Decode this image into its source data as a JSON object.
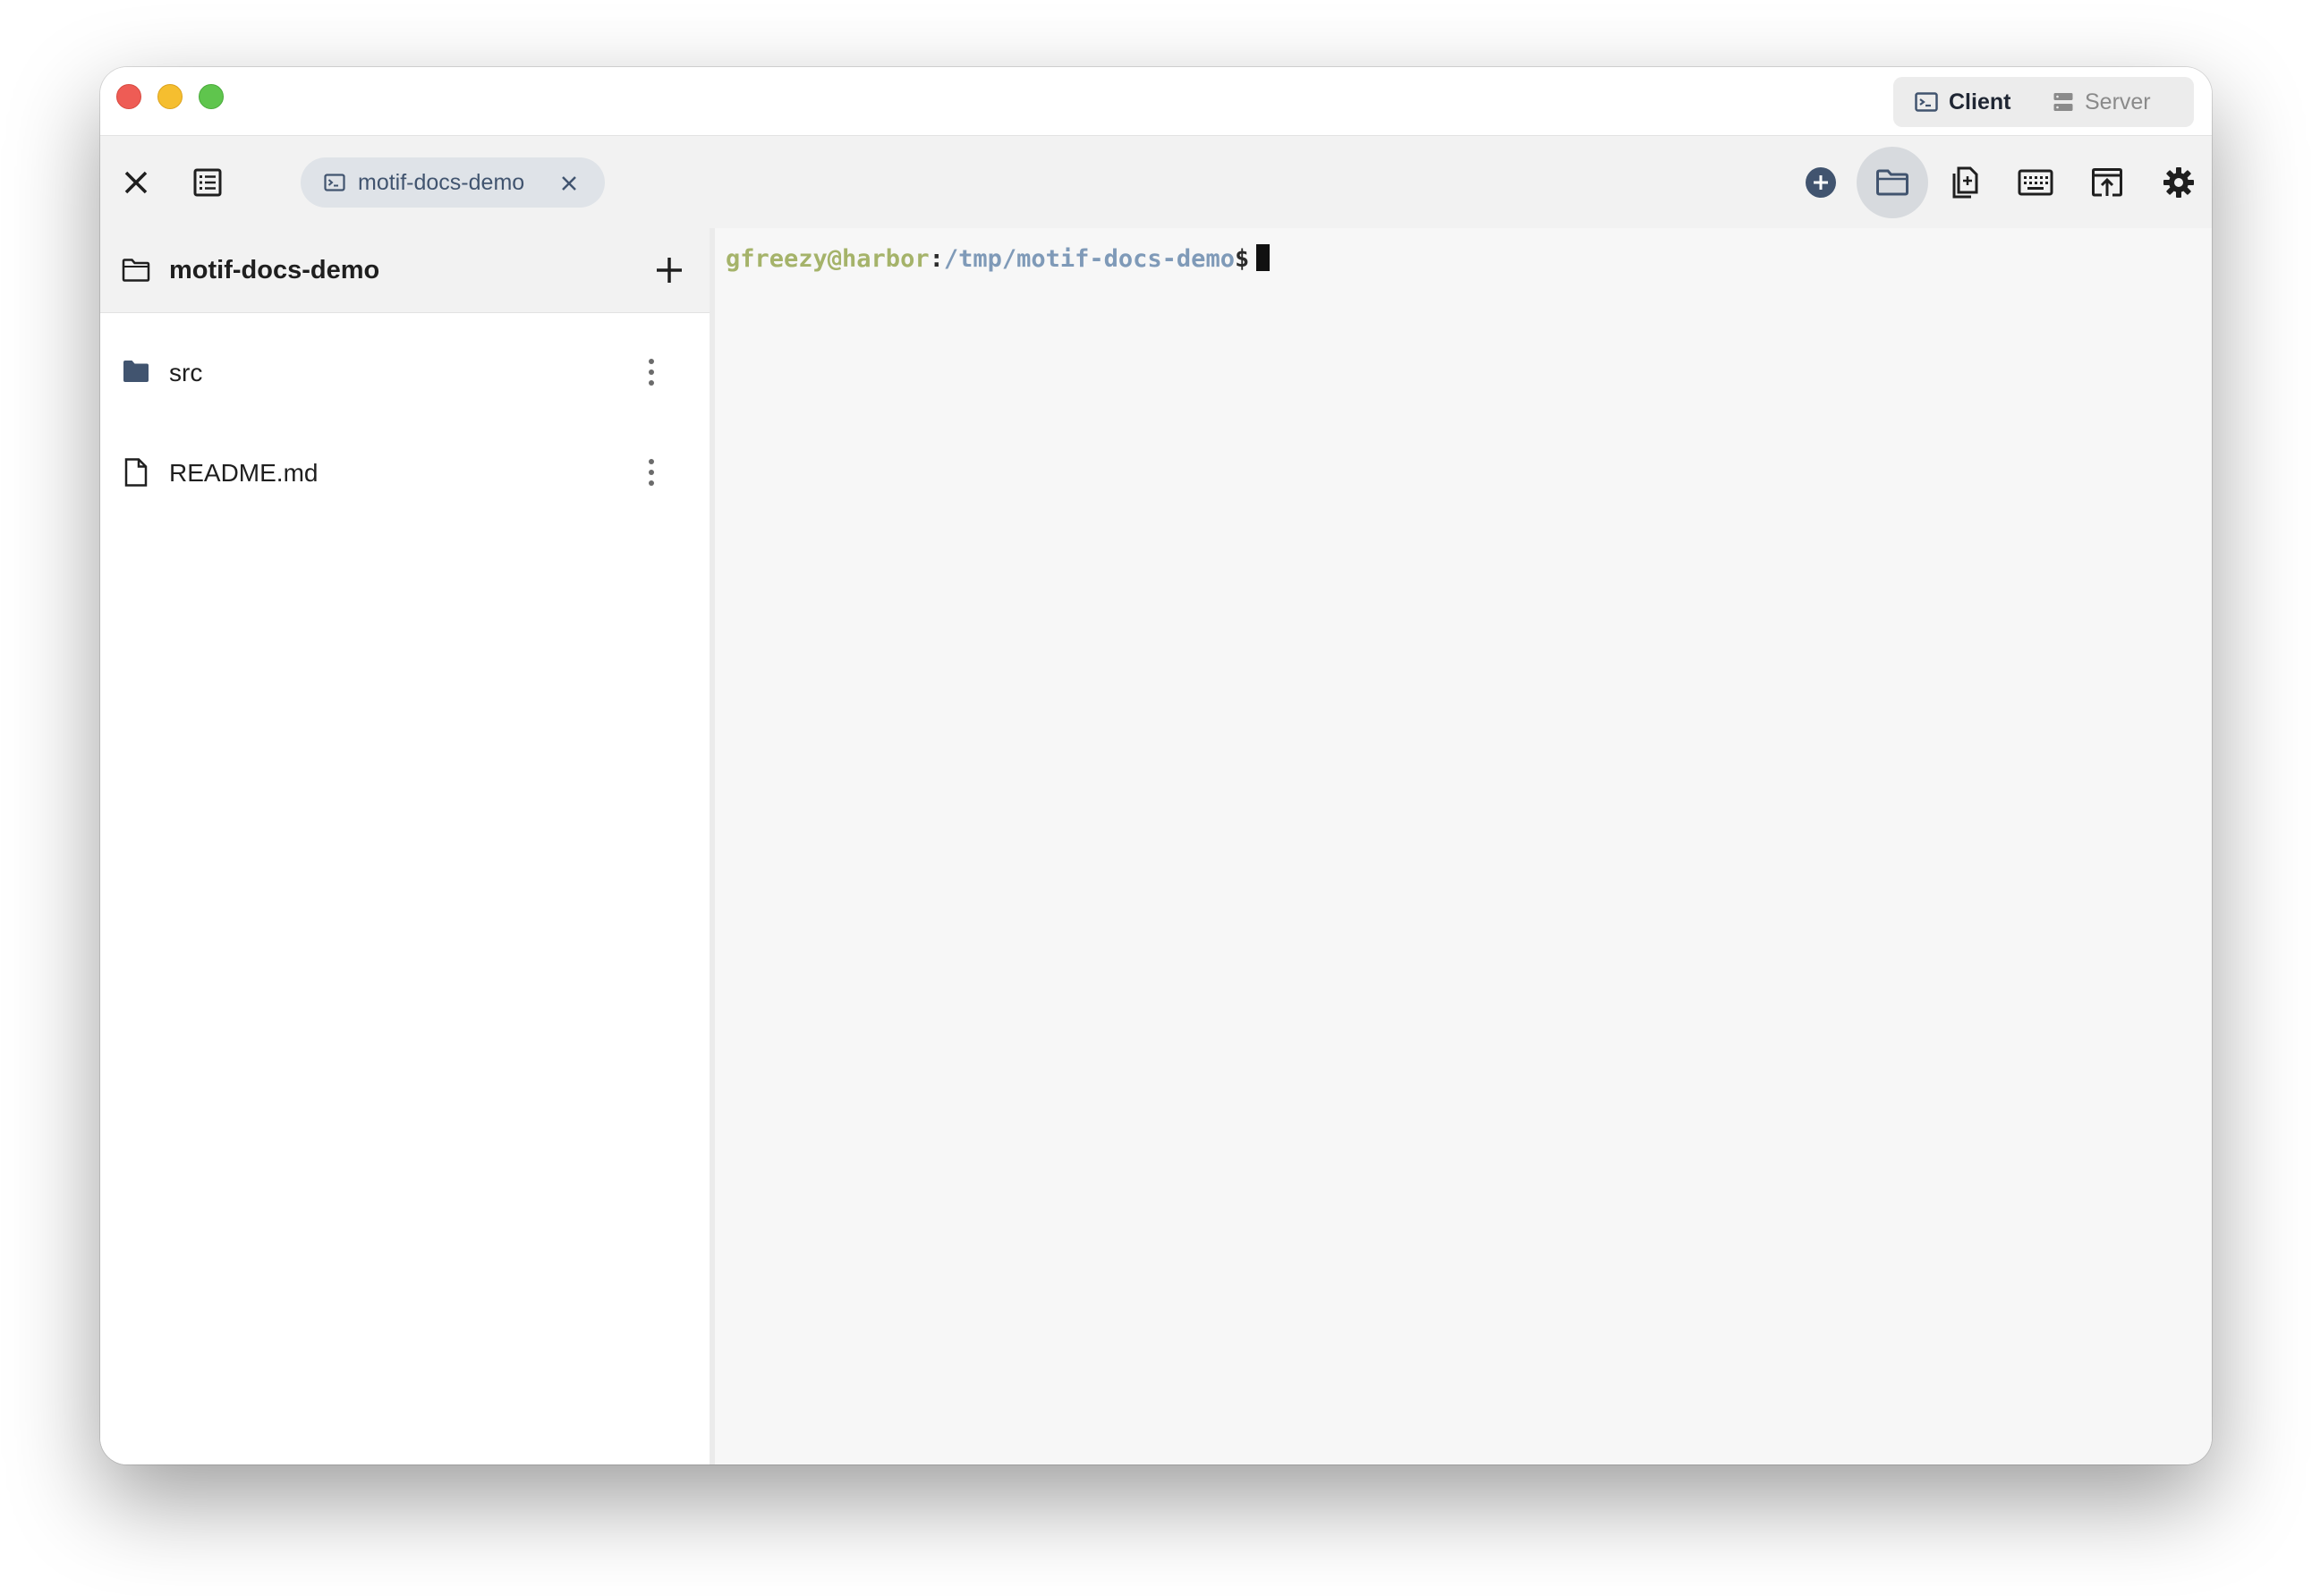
{
  "window": {
    "controls": [
      "close",
      "minimize",
      "maximize"
    ]
  },
  "mode_switch": {
    "client_label": "Client",
    "server_label": "Server",
    "selected": "Client"
  },
  "toolbar": {
    "left_icons": [
      "close-icon",
      "list-view-icon"
    ],
    "right_icons": [
      "add-circle-icon",
      "folder-icon",
      "copy-file-icon",
      "keyboard-icon",
      "upload-window-icon",
      "gear-icon"
    ],
    "active_icon": "folder-icon"
  },
  "tabs": [
    {
      "label": "motif-docs-demo",
      "icon": "terminal-icon"
    }
  ],
  "sidebar": {
    "title": "motif-docs-demo",
    "items": [
      {
        "label": "src",
        "type": "folder"
      },
      {
        "label": "README.md",
        "type": "file"
      }
    ]
  },
  "terminal": {
    "user_host": "gfreezy@harbor",
    "separator": ":",
    "path": "/tmp/motif-docs-demo",
    "prompt_symbol": "$"
  },
  "colors": {
    "accent": "#41546f",
    "prompt_user": "#a5b36a",
    "prompt_path": "#7f9ab8",
    "tab_bg": "#dfe3e8"
  }
}
